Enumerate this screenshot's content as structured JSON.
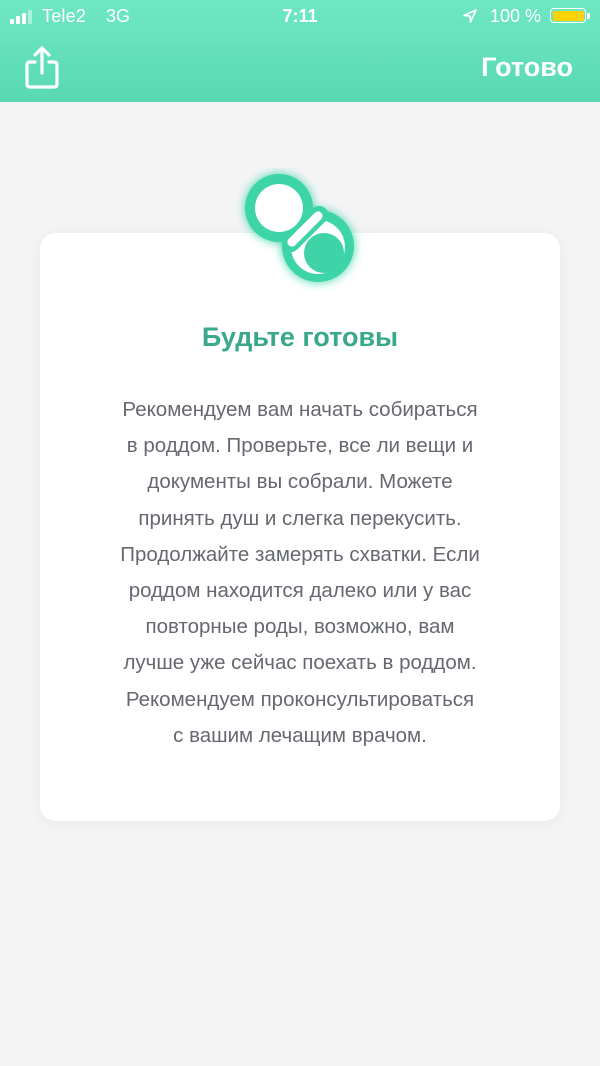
{
  "status_bar": {
    "carrier": "Tele2",
    "network": "3G",
    "time": "7:11",
    "battery_percent": "100 %",
    "signal_icon": "signal-bars-icon",
    "location_icon": "location-arrow-icon",
    "battery_icon": "battery-icon",
    "battery_color": "#ffd20a"
  },
  "header": {
    "share_icon": "share-icon",
    "done_label": "Готово",
    "background_color": "#6fe8c2"
  },
  "card": {
    "icon": "pacifier-icon",
    "title": "Будьте готовы",
    "text": "Рекомендуем вам начать собираться\nв роддом. Проверьте, все ли вещи и\nдокументы вы собрали. Можете\nпринять душ и слегка перекусить.\nПродолжайте замерять схватки. Если\nроддом находится далеко или у вас\nповторные роды, возможно, вам\nлучше уже сейчас поехать в роддом.\nРекомендуем проконсультироваться\nс вашим лечащим врачом.",
    "accent_color": "#3aa88a"
  }
}
